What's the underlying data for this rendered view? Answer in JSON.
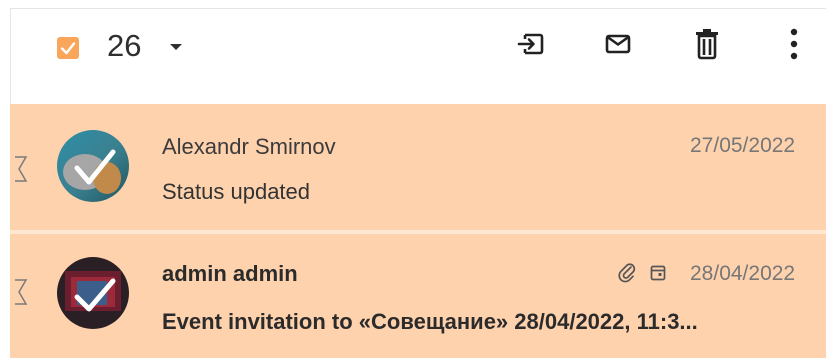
{
  "toolbar": {
    "selected_count": "26",
    "icons": [
      "move-to-folder-icon",
      "mark-read-icon",
      "delete-icon",
      "more-options-icon"
    ],
    "checkbox_color": "#f9a65a"
  },
  "messages": [
    {
      "sender": "Alexandr Smirnov",
      "subject": "Status updated",
      "date": "27/05/2022",
      "unread": false,
      "has_attachment": false,
      "has_event": false
    },
    {
      "sender": "admin admin",
      "subject": "Event invitation to «Совещание» 28/04/2022, 11:3...",
      "date": "28/04/2022",
      "unread": true,
      "has_attachment": true,
      "has_event": true
    }
  ],
  "colors": {
    "selected_row": "#ffd2ae",
    "accent": "#f9a65a"
  }
}
